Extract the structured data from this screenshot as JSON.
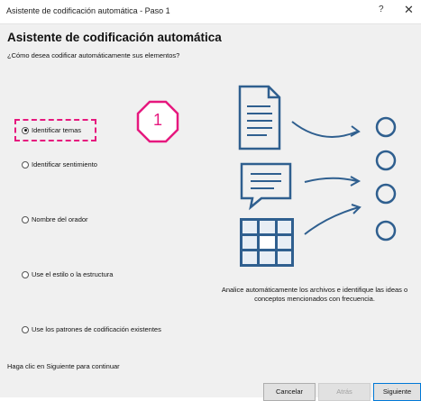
{
  "window": {
    "title": "Asistente de codificación automática - Paso 1",
    "help_glyph": "?",
    "close_glyph": "✕"
  },
  "header": {
    "title": "Asistente de codificación automática",
    "question": "¿Cómo desea codificar automáticamente sus elementos?"
  },
  "options": [
    {
      "label": "Identificar temas",
      "selected": true
    },
    {
      "label": "Identificar sentimiento",
      "selected": false
    },
    {
      "label": "Nombre del orador",
      "selected": false
    },
    {
      "label": "Use el estilo o la estructura",
      "selected": false
    },
    {
      "label": "Use los patrones de codificación existentes",
      "selected": false
    }
  ],
  "callout": {
    "number": "1",
    "color": "#e6187e"
  },
  "illustration": {
    "icons": [
      "document-icon",
      "chat-icon",
      "table-icon",
      "arrow-icon",
      "circle-icon"
    ],
    "color": "#2f5f8f"
  },
  "description": "Analice automáticamente los archivos e identifique las ideas o conceptos mencionados con frecuencia.",
  "footer": {
    "hint": "Haga clic en Siguiente para continuar",
    "cancel_label": "Cancelar",
    "back_label": "Atrás",
    "next_label": "Siguiente"
  }
}
